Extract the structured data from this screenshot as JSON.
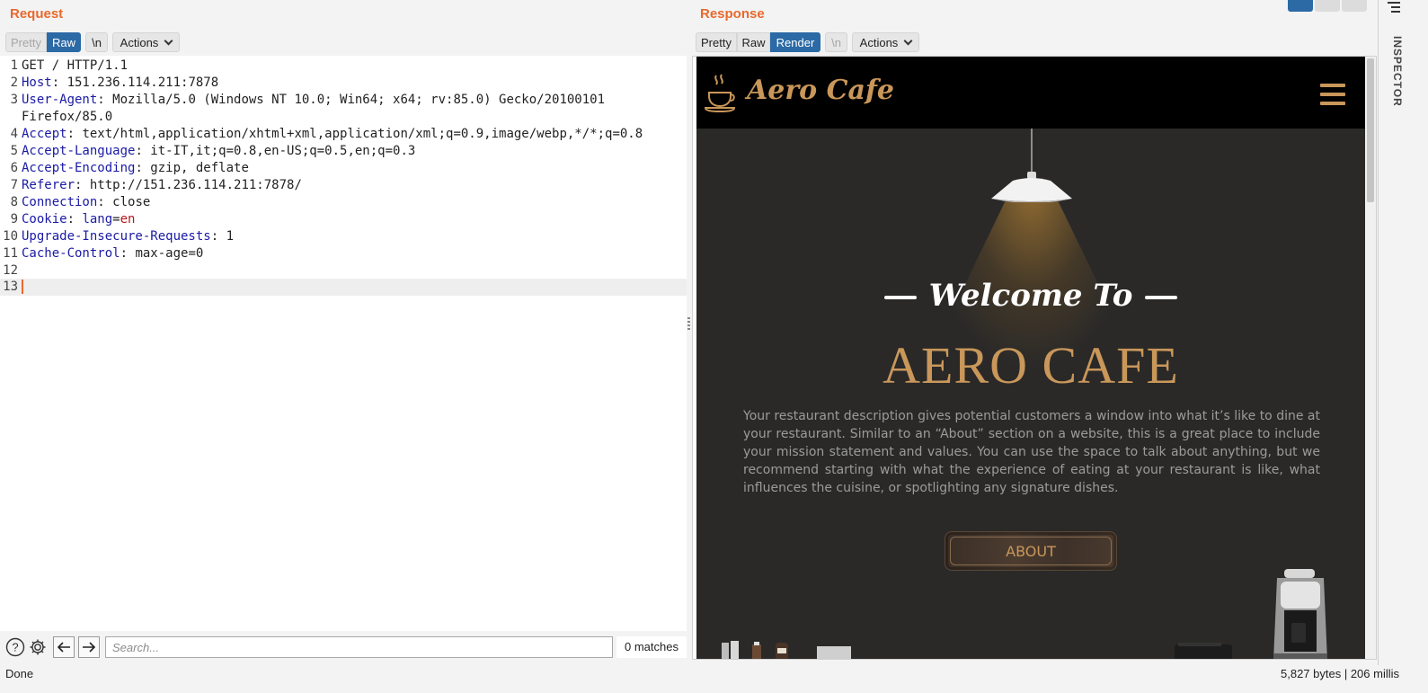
{
  "request": {
    "title": "Request",
    "toolbar": {
      "pretty": "Pretty",
      "raw": "Raw",
      "newline": "\\n",
      "actions": "Actions"
    },
    "lines": [
      {
        "n": "1",
        "key": "GET / HTTP/1.1",
        "sep": "",
        "val": ""
      },
      {
        "n": "2",
        "key": "Host",
        "sep": ": ",
        "val": "151.236.114.211:7878"
      },
      {
        "n": "3",
        "key": "User-Agent",
        "sep": ": ",
        "val": "Mozilla/5.0 (Windows NT 10.0; Win64; x64; rv:85.0) Gecko/20100101"
      },
      {
        "n": "",
        "key": "",
        "sep": "",
        "val": "Firefox/85.0"
      },
      {
        "n": "4",
        "key": "Accept",
        "sep": ": ",
        "val": "text/html,application/xhtml+xml,application/xml;q=0.9,image/webp,*/*;q=0.8"
      },
      {
        "n": "5",
        "key": "Accept-Language",
        "sep": ": ",
        "val": "it-IT,it;q=0.8,en-US;q=0.5,en;q=0.3"
      },
      {
        "n": "6",
        "key": "Accept-Encoding",
        "sep": ": ",
        "val": "gzip, deflate"
      },
      {
        "n": "7",
        "key": "Referer",
        "sep": ": ",
        "val": "http://151.236.114.211:7878/"
      },
      {
        "n": "8",
        "key": "Connection",
        "sep": ": ",
        "val": "close"
      },
      {
        "n": "9",
        "key": "Cookie",
        "sep": ": ",
        "val": ""
      },
      {
        "n": "10",
        "key": "Upgrade-Insecure-Requests",
        "sep": ": ",
        "val": "1"
      },
      {
        "n": "11",
        "key": "Cache-Control",
        "sep": ": ",
        "val": "max-age=0"
      },
      {
        "n": "12",
        "key": "",
        "sep": "",
        "val": ""
      },
      {
        "n": "13",
        "key": "",
        "sep": "",
        "val": ""
      }
    ],
    "cookie": {
      "name": "lang",
      "eq": "=",
      "value": "en"
    },
    "search": {
      "placeholder": "Search...",
      "matches": "0 matches"
    }
  },
  "response": {
    "title": "Response",
    "toolbar": {
      "pretty": "Pretty",
      "raw": "Raw",
      "render": "Render",
      "newline": "\\n",
      "actions": "Actions"
    },
    "site": {
      "brand": "Aero Cafe",
      "welcome": "Welcome To",
      "hero_title": "AERO CAFE",
      "description": "Your restaurant description gives potential customers a window into what it’s like to dine at your restaurant. Similar to an “About” section on a website, this is a great place to include your mission statement and values. You can use the space to talk about anything, but we recommend starting with what the experience of eating at your restaurant is like, what influences the cuisine, or spotlighting any signature dishes.",
      "about_button": "ABOUT",
      "gold": "#c9975a"
    }
  },
  "inspector": {
    "label": "INSPECTOR"
  },
  "status": {
    "left": "Done",
    "right": "5,827 bytes | 206 millis"
  },
  "colors": {
    "accent": "#e8692c",
    "active": "#2b6aa5"
  }
}
